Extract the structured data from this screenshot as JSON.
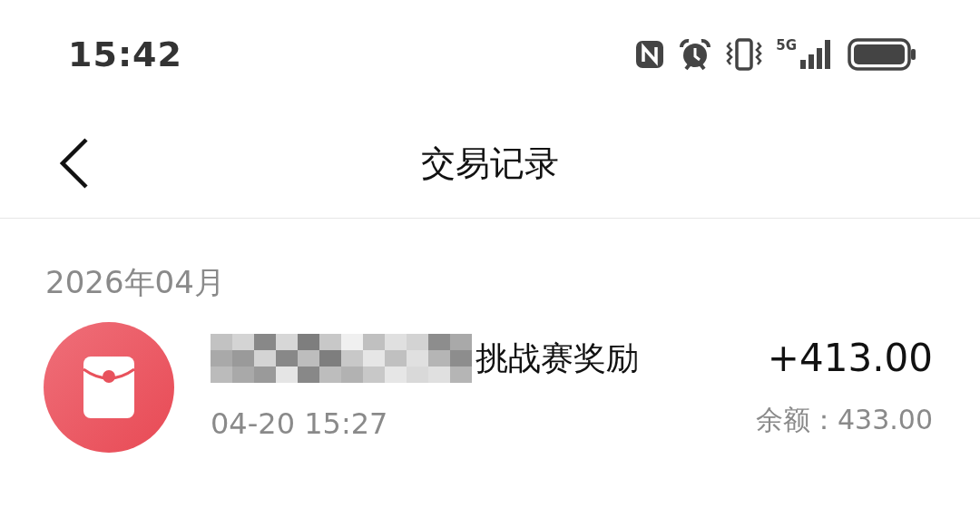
{
  "status_bar": {
    "time": "15:42",
    "network": "5G"
  },
  "header": {
    "title": "交易记录"
  },
  "sections": [
    {
      "month": "2026年04月",
      "transactions": [
        {
          "title": "挑战赛奖励",
          "redacted": true,
          "time": "04-20 15:27",
          "amount": "+413.00",
          "balance": "余额：433.00"
        }
      ]
    }
  ]
}
